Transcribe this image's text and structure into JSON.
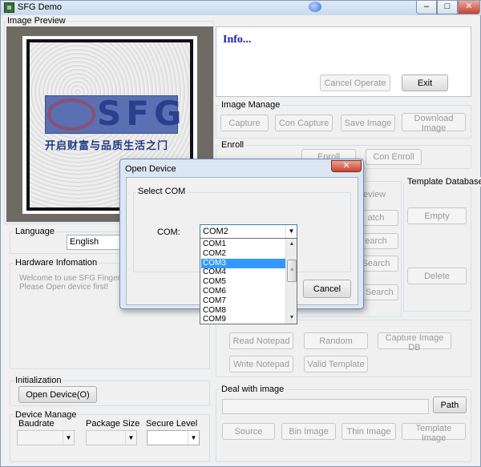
{
  "window": {
    "title": "SFG Demo",
    "minimize": "–",
    "maximize": "□",
    "close": "✕"
  },
  "image_preview": {
    "label": "Image Preview",
    "logo_text": "SFG",
    "slogan": "开启财富与品质生活之门"
  },
  "info": {
    "title": "Info...",
    "cancel_operate": "Cancel Operate",
    "exit": "Exit"
  },
  "image_manage": {
    "label": "Image Manage",
    "capture": "Capture",
    "con_capture": "Con Capture",
    "save_image": "Save Image",
    "download_image": "Download Image"
  },
  "enroll": {
    "label": "Enroll",
    "checkbox_label": "Preview",
    "enroll_btn": "Enroll",
    "con_enroll": "Con Enroll"
  },
  "search_panel": {
    "preview": "eview",
    "match": "atch",
    "search": "earch",
    "search2": "Search",
    "quick_search": "k Search"
  },
  "template_db": {
    "label": "Template Database",
    "empty": "Empty",
    "delete": "Delete"
  },
  "language": {
    "label": "Language",
    "value": "English"
  },
  "hardware": {
    "label": "Hardware Infomation",
    "line1": "Welcome to use SFG Fingerp",
    "line2": "Please Open device first!"
  },
  "notepad": {
    "read": "Read Notepad",
    "random": "Random",
    "capture_db": "Capture Image DB",
    "write": "Write Notepad",
    "valid_template": "Valid Template"
  },
  "initialization": {
    "label": "Initialization",
    "open_device": "Open Device(O)"
  },
  "device_manage": {
    "label": "Device Manage",
    "baudrate": "Baudrate",
    "package_size": "Package Size",
    "secure_level": "Secure Level"
  },
  "deal": {
    "label": "Deal with image",
    "path": "Path",
    "source": "Source",
    "bin": "Bin Image",
    "thin": "Thin Image",
    "template": "Template Image"
  },
  "dialog": {
    "title": "Open Device",
    "close": "✕",
    "group_label": "Select COM",
    "com_label": "COM:",
    "com_value": "COM2",
    "cancel": "Cancel",
    "options": [
      "COM1",
      "COM2",
      "COM3",
      "COM4",
      "COM5",
      "COM6",
      "COM7",
      "COM8",
      "COM9"
    ],
    "selected": "COM3"
  }
}
